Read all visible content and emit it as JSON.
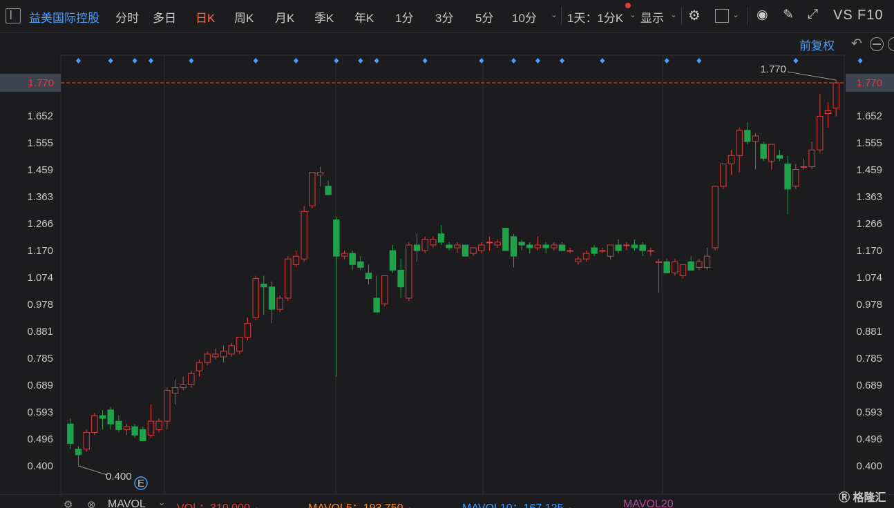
{
  "toolbar": {
    "stock_name": "益美国际控股",
    "tabs": [
      "分时",
      "多日",
      "日K",
      "周K",
      "月K",
      "季K",
      "年K",
      "1分",
      "3分",
      "5分",
      "10分"
    ],
    "active_tab": "日K",
    "period_select": "1天：1分K",
    "display": "显示",
    "vs": "VS",
    "f10": "F10"
  },
  "adjust_label": "前复权",
  "bottom": {
    "mavol": "MAVOL",
    "vol": "VOL：310.000",
    "mavol5": "MAVOL5：193.750",
    "mavol10": "MAVOL10：167.125",
    "mavol20": "MAVOL20",
    "logo": "格隆汇"
  },
  "colors": {
    "up": "#e23b3b",
    "down": "#1fa24a",
    "marker": "#4a9eff",
    "active": "#ff6b3d"
  },
  "chart_data": {
    "type": "candlestick",
    "y_ticks": [
      "1.770",
      "1.652",
      "1.555",
      "1.459",
      "1.363",
      "1.266",
      "1.170",
      "1.074",
      "0.978",
      "0.881",
      "0.785",
      "0.689",
      "0.593",
      "0.496",
      "0.400"
    ],
    "ylim": [
      0.4,
      1.77
    ],
    "current_price_label": "1.770",
    "max_label": "1.770",
    "min_label": "0.400",
    "event_marker": "E",
    "dividend_marker_indices": [
      1,
      5,
      8,
      10,
      15,
      23,
      28,
      33,
      36,
      38,
      44,
      51,
      55,
      58,
      61,
      66,
      74,
      78,
      90,
      98
    ],
    "candles": [
      {
        "o": 0.55,
        "h": 0.57,
        "l": 0.46,
        "c": 0.48
      },
      {
        "o": 0.46,
        "h": 0.47,
        "l": 0.4,
        "c": 0.44
      },
      {
        "o": 0.46,
        "h": 0.53,
        "l": 0.45,
        "c": 0.52
      },
      {
        "o": 0.52,
        "h": 0.59,
        "l": 0.51,
        "c": 0.58
      },
      {
        "o": 0.58,
        "h": 0.6,
        "l": 0.53,
        "c": 0.57
      },
      {
        "o": 0.6,
        "h": 0.61,
        "l": 0.53,
        "c": 0.55
      },
      {
        "o": 0.56,
        "h": 0.58,
        "l": 0.52,
        "c": 0.53
      },
      {
        "o": 0.53,
        "h": 0.55,
        "l": 0.51,
        "c": 0.54
      },
      {
        "o": 0.54,
        "h": 0.55,
        "l": 0.5,
        "c": 0.51
      },
      {
        "o": 0.53,
        "h": 0.54,
        "l": 0.49,
        "c": 0.49
      },
      {
        "o": 0.51,
        "h": 0.62,
        "l": 0.5,
        "c": 0.56
      },
      {
        "o": 0.53,
        "h": 0.57,
        "l": 0.52,
        "c": 0.56
      },
      {
        "o": 0.56,
        "h": 0.68,
        "l": 0.53,
        "c": 0.67
      },
      {
        "o": 0.66,
        "h": 0.71,
        "l": 0.62,
        "c": 0.68
      },
      {
        "o": 0.68,
        "h": 0.72,
        "l": 0.67,
        "c": 0.69
      },
      {
        "o": 0.69,
        "h": 0.74,
        "l": 0.68,
        "c": 0.73
      },
      {
        "o": 0.74,
        "h": 0.78,
        "l": 0.72,
        "c": 0.77
      },
      {
        "o": 0.77,
        "h": 0.81,
        "l": 0.76,
        "c": 0.8
      },
      {
        "o": 0.79,
        "h": 0.82,
        "l": 0.78,
        "c": 0.8
      },
      {
        "o": 0.79,
        "h": 0.83,
        "l": 0.77,
        "c": 0.81
      },
      {
        "o": 0.8,
        "h": 0.84,
        "l": 0.79,
        "c": 0.83
      },
      {
        "o": 0.81,
        "h": 0.86,
        "l": 0.8,
        "c": 0.86
      },
      {
        "o": 0.86,
        "h": 0.93,
        "l": 0.85,
        "c": 0.91
      },
      {
        "o": 0.93,
        "h": 1.08,
        "l": 0.92,
        "c": 1.07
      },
      {
        "o": 1.05,
        "h": 1.08,
        "l": 0.94,
        "c": 1.04
      },
      {
        "o": 1.04,
        "h": 1.06,
        "l": 0.91,
        "c": 0.96
      },
      {
        "o": 0.96,
        "h": 1.01,
        "l": 0.95,
        "c": 1.0
      },
      {
        "o": 1.0,
        "h": 1.15,
        "l": 0.99,
        "c": 1.14
      },
      {
        "o": 1.12,
        "h": 1.17,
        "l": 1.11,
        "c": 1.15
      },
      {
        "o": 1.14,
        "h": 1.33,
        "l": 1.13,
        "c": 1.31
      },
      {
        "o": 1.33,
        "h": 1.45,
        "l": 1.32,
        "c": 1.45
      },
      {
        "o": 1.44,
        "h": 1.47,
        "l": 1.4,
        "c": 1.45
      },
      {
        "o": 1.4,
        "h": 1.42,
        "l": 1.37,
        "c": 1.37
      },
      {
        "o": 1.28,
        "h": 1.29,
        "l": 0.72,
        "c": 1.15
      },
      {
        "o": 1.15,
        "h": 1.17,
        "l": 1.14,
        "c": 1.16
      },
      {
        "o": 1.16,
        "h": 1.17,
        "l": 1.1,
        "c": 1.12
      },
      {
        "o": 1.13,
        "h": 1.15,
        "l": 1.1,
        "c": 1.11
      },
      {
        "o": 1.09,
        "h": 1.12,
        "l": 1.05,
        "c": 1.07
      },
      {
        "o": 1.0,
        "h": 1.08,
        "l": 0.95,
        "c": 0.95
      },
      {
        "o": 0.98,
        "h": 1.08,
        "l": 0.97,
        "c": 1.08
      },
      {
        "o": 1.17,
        "h": 1.19,
        "l": 1.09,
        "c": 1.1
      },
      {
        "o": 1.1,
        "h": 1.14,
        "l": 1.0,
        "c": 1.04
      },
      {
        "o": 1.0,
        "h": 1.2,
        "l": 0.99,
        "c": 1.19
      },
      {
        "o": 1.19,
        "h": 1.23,
        "l": 1.13,
        "c": 1.17
      },
      {
        "o": 1.17,
        "h": 1.22,
        "l": 1.16,
        "c": 1.21
      },
      {
        "o": 1.19,
        "h": 1.22,
        "l": 1.18,
        "c": 1.21
      },
      {
        "o": 1.23,
        "h": 1.26,
        "l": 1.19,
        "c": 1.2
      },
      {
        "o": 1.19,
        "h": 1.2,
        "l": 1.17,
        "c": 1.18
      },
      {
        "o": 1.18,
        "h": 1.2,
        "l": 1.16,
        "c": 1.19
      },
      {
        "o": 1.19,
        "h": 1.19,
        "l": 1.15,
        "c": 1.15
      },
      {
        "o": 1.16,
        "h": 1.18,
        "l": 1.15,
        "c": 1.18
      },
      {
        "o": 1.17,
        "h": 1.2,
        "l": 1.16,
        "c": 1.19
      },
      {
        "o": 1.2,
        "h": 1.22,
        "l": 1.17,
        "c": 1.2
      },
      {
        "o": 1.19,
        "h": 1.21,
        "l": 1.18,
        "c": 1.2
      },
      {
        "o": 1.25,
        "h": 1.25,
        "l": 1.17,
        "c": 1.17
      },
      {
        "o": 1.22,
        "h": 1.23,
        "l": 1.11,
        "c": 1.15
      },
      {
        "o": 1.2,
        "h": 1.21,
        "l": 1.17,
        "c": 1.19
      },
      {
        "o": 1.19,
        "h": 1.2,
        "l": 1.16,
        "c": 1.18
      },
      {
        "o": 1.18,
        "h": 1.22,
        "l": 1.17,
        "c": 1.19
      },
      {
        "o": 1.19,
        "h": 1.2,
        "l": 1.16,
        "c": 1.18
      },
      {
        "o": 1.18,
        "h": 1.2,
        "l": 1.17,
        "c": 1.19
      },
      {
        "o": 1.19,
        "h": 1.2,
        "l": 1.17,
        "c": 1.17
      },
      {
        "o": 1.17,
        "h": 1.18,
        "l": 1.16,
        "c": 1.17
      },
      {
        "o": 1.13,
        "h": 1.15,
        "l": 1.12,
        "c": 1.14
      },
      {
        "o": 1.14,
        "h": 1.17,
        "l": 1.13,
        "c": 1.16
      },
      {
        "o": 1.18,
        "h": 1.19,
        "l": 1.15,
        "c": 1.16
      },
      {
        "o": 1.17,
        "h": 1.18,
        "l": 1.16,
        "c": 1.17
      },
      {
        "o": 1.15,
        "h": 1.19,
        "l": 1.14,
        "c": 1.19
      },
      {
        "o": 1.19,
        "h": 1.21,
        "l": 1.16,
        "c": 1.17
      },
      {
        "o": 1.19,
        "h": 1.2,
        "l": 1.17,
        "c": 1.19
      },
      {
        "o": 1.19,
        "h": 1.21,
        "l": 1.17,
        "c": 1.18
      },
      {
        "o": 1.19,
        "h": 1.2,
        "l": 1.15,
        "c": 1.17
      },
      {
        "o": 1.17,
        "h": 1.18,
        "l": 1.15,
        "c": 1.17
      },
      {
        "o": 1.13,
        "h": 1.14,
        "l": 1.02,
        "c": 1.13
      },
      {
        "o": 1.13,
        "h": 1.14,
        "l": 1.09,
        "c": 1.09
      },
      {
        "o": 1.09,
        "h": 1.14,
        "l": 1.08,
        "c": 1.13
      },
      {
        "o": 1.08,
        "h": 1.12,
        "l": 1.07,
        "c": 1.12
      },
      {
        "o": 1.13,
        "h": 1.15,
        "l": 1.1,
        "c": 1.1
      },
      {
        "o": 1.11,
        "h": 1.14,
        "l": 1.1,
        "c": 1.13
      },
      {
        "o": 1.11,
        "h": 1.18,
        "l": 1.1,
        "c": 1.15
      },
      {
        "o": 1.18,
        "h": 1.39,
        "l": 1.17,
        "c": 1.4
      },
      {
        "o": 1.4,
        "h": 1.48,
        "l": 1.39,
        "c": 1.48
      },
      {
        "o": 1.48,
        "h": 1.53,
        "l": 1.44,
        "c": 1.51
      },
      {
        "o": 1.51,
        "h": 1.61,
        "l": 1.45,
        "c": 1.6
      },
      {
        "o": 1.6,
        "h": 1.63,
        "l": 1.55,
        "c": 1.56
      },
      {
        "o": 1.56,
        "h": 1.59,
        "l": 1.46,
        "c": 1.58
      },
      {
        "o": 1.55,
        "h": 1.56,
        "l": 1.49,
        "c": 1.5
      },
      {
        "o": 1.49,
        "h": 1.55,
        "l": 1.46,
        "c": 1.55
      },
      {
        "o": 1.51,
        "h": 1.53,
        "l": 1.49,
        "c": 1.5
      },
      {
        "o": 1.48,
        "h": 1.51,
        "l": 1.3,
        "c": 1.39
      },
      {
        "o": 1.4,
        "h": 1.48,
        "l": 1.39,
        "c": 1.46
      },
      {
        "o": 1.47,
        "h": 1.5,
        "l": 1.46,
        "c": 1.47
      },
      {
        "o": 1.47,
        "h": 1.56,
        "l": 1.46,
        "c": 1.53
      },
      {
        "o": 1.53,
        "h": 1.73,
        "l": 1.52,
        "c": 1.65
      },
      {
        "o": 1.66,
        "h": 1.7,
        "l": 1.61,
        "c": 1.67
      },
      {
        "o": 1.68,
        "h": 1.78,
        "l": 1.65,
        "c": 1.77
      }
    ]
  }
}
